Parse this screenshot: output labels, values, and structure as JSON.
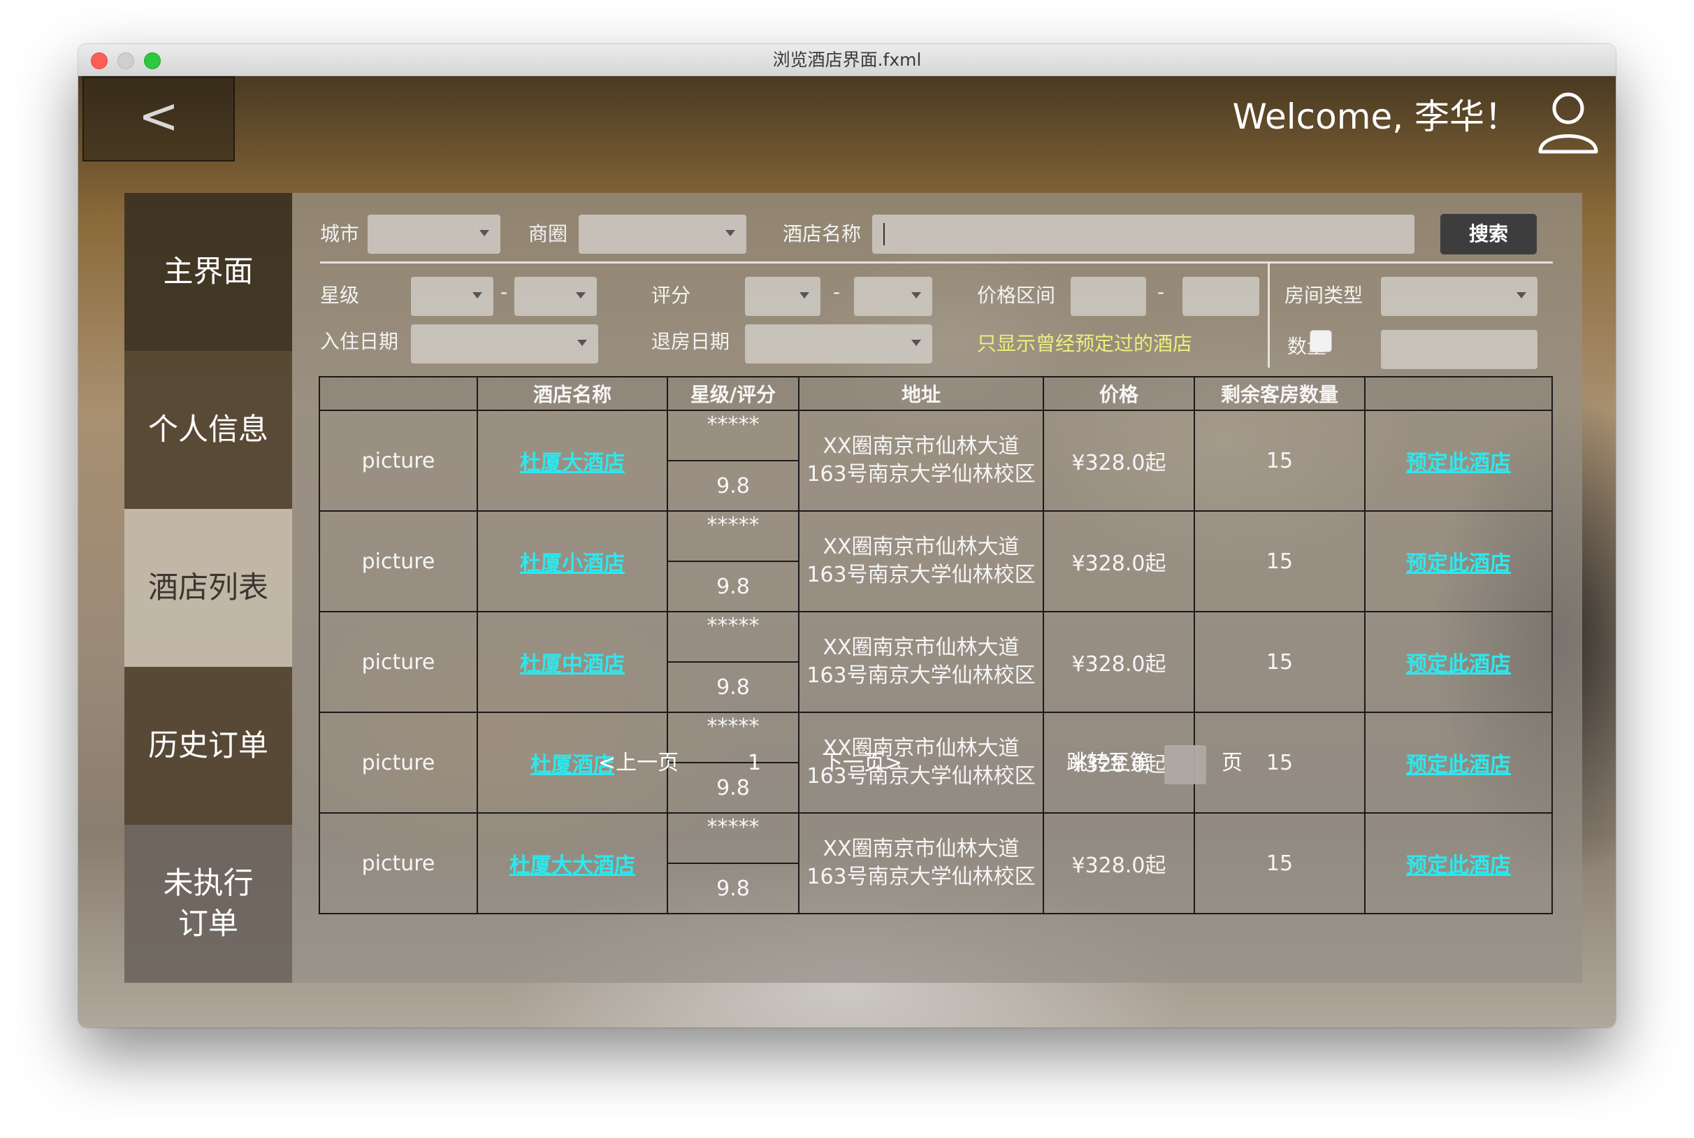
{
  "window": {
    "title": "浏览酒店界面.fxml"
  },
  "header": {
    "back_label": "<",
    "welcome": "Welcome, 李华！"
  },
  "sidebar": {
    "items": [
      {
        "label": "主界面"
      },
      {
        "label": "个人信息"
      },
      {
        "label": "酒店列表",
        "selected": true
      },
      {
        "label": "历史订单"
      },
      {
        "label": "未执行\n订单"
      }
    ]
  },
  "filters": {
    "city_label": "城市",
    "district_label": "商圈",
    "hotel_name_label": "酒店名称",
    "hotel_name_value": "",
    "search_label": "搜索",
    "star_label": "星级",
    "rating_label": "评分",
    "price_label": "价格区间",
    "room_type_label": "房间类型",
    "checkin_label": "入住日期",
    "checkout_label": "退房日期",
    "only_booked_label": "只显示曾经预定过的酒店",
    "only_booked_checked": false,
    "quantity_label": "数量",
    "dash": "-"
  },
  "table": {
    "headers": [
      "",
      "酒店名称",
      "星级/评分",
      "地址",
      "价格",
      "剩余客房数量",
      ""
    ],
    "rows": [
      {
        "picture": "picture",
        "name": "杜厦大酒店",
        "stars": "*****",
        "rating": "9.8",
        "address_line1": "XX圈南京市仙林大道",
        "address_line2": "163号南京大学仙林校区",
        "price": "¥328.0起",
        "rooms": "15",
        "action": "预定此酒店"
      },
      {
        "picture": "picture",
        "name": "杜厦小酒店",
        "stars": "*****",
        "rating": "9.8",
        "address_line1": "XX圈南京市仙林大道",
        "address_line2": "163号南京大学仙林校区",
        "price": "¥328.0起",
        "rooms": "15",
        "action": "预定此酒店"
      },
      {
        "picture": "picture",
        "name": "杜厦中酒店",
        "stars": "*****",
        "rating": "9.8",
        "address_line1": "XX圈南京市仙林大道",
        "address_line2": "163号南京大学仙林校区",
        "price": "¥328.0起",
        "rooms": "15",
        "action": "预定此酒店"
      },
      {
        "picture": "picture",
        "name": "杜厦酒店",
        "stars": "*****",
        "rating": "9.8",
        "address_line1": "XX圈南京市仙林大道",
        "address_line2": "163号南京大学仙林校区",
        "price": "¥328.0起",
        "rooms": "15",
        "action": "预定此酒店"
      },
      {
        "picture": "picture",
        "name": "杜厦大大酒店",
        "stars": "*****",
        "rating": "9.8",
        "address_line1": "XX圈南京市仙林大道",
        "address_line2": "163号南京大学仙林校区",
        "price": "¥328.0起",
        "rooms": "15",
        "action": "预定此酒店"
      }
    ]
  },
  "pagination": {
    "prev_label": "<上一页",
    "current_page": "1",
    "next_label": "下一页>",
    "jump_label": "跳转至第",
    "page_suffix": "页",
    "jump_value": ""
  },
  "colors": {
    "link": "#2ce8ef",
    "highlight_label": "#e9f07a"
  }
}
